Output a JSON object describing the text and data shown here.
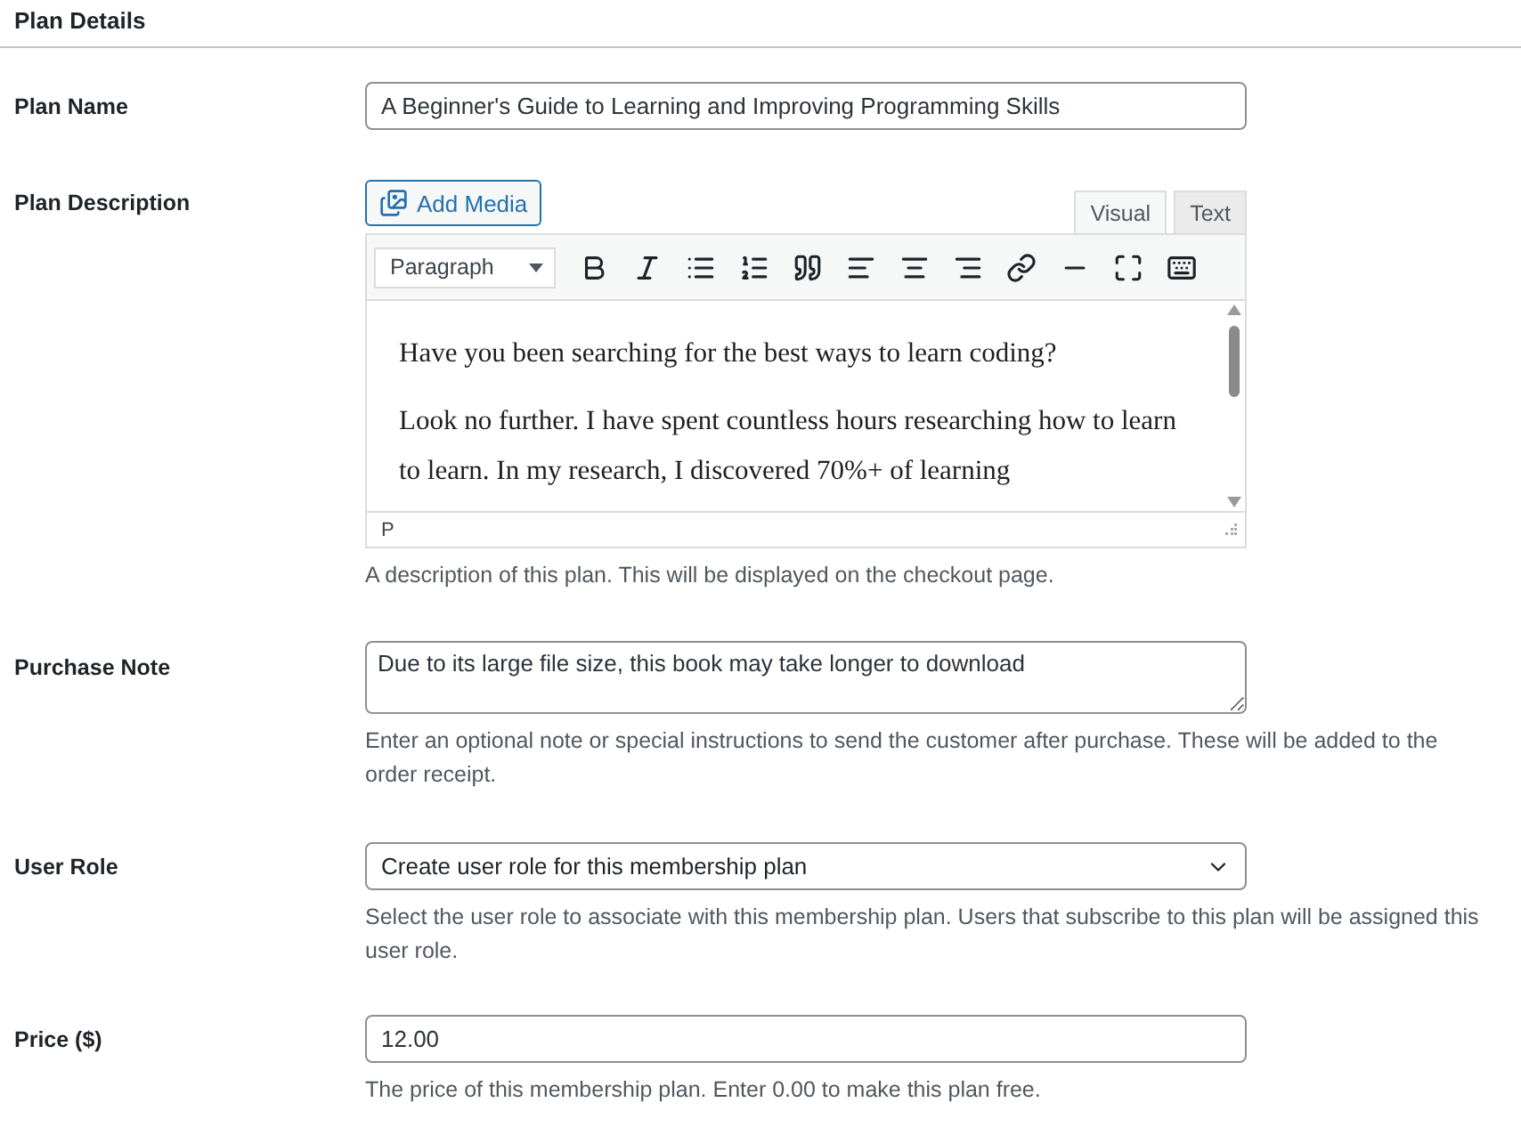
{
  "section_title": "Plan Details",
  "plan_name": {
    "label": "Plan Name",
    "value": "A Beginner's Guide to Learning and Improving Programming Skills"
  },
  "plan_description": {
    "label": "Plan Description",
    "add_media": "Add Media",
    "tabs": [
      {
        "label": "Visual",
        "selected": true
      },
      {
        "label": "Text",
        "selected": false
      }
    ],
    "format": "Paragraph",
    "toolbar": [
      {
        "kind": "bold"
      },
      {
        "kind": "italic"
      },
      {
        "kind": "bullets"
      },
      {
        "kind": "numbers"
      },
      {
        "kind": "quote"
      },
      {
        "kind": "align-left"
      },
      {
        "kind": "align-center"
      },
      {
        "kind": "align-right"
      },
      {
        "kind": "link"
      },
      {
        "kind": "more"
      },
      {
        "kind": "fullscreen"
      },
      {
        "kind": "kitchen-sink"
      }
    ],
    "paragraphs": [
      "Have you been searching for the best ways to learn coding?",
      "Look no further. I have spent countless hours researching how to learn to learn. In my research, I discovered 70%+ of learning"
    ],
    "path": "P",
    "hint": "A description of this plan. This will be displayed on the checkout page."
  },
  "purchase_note": {
    "label": "Purchase Note",
    "value": "Due to its large file size, this book may take longer to download",
    "hint": "Enter an optional note or special instructions to send the customer after purchase. These will be added to the order receipt."
  },
  "user_role": {
    "label": "User Role",
    "value": "Create user role for this membership plan",
    "hint": "Select the user role to associate with this membership plan. Users that subscribe to this plan will be assigned this user role."
  },
  "price": {
    "label": "Price ($)",
    "value": "12.00",
    "hint": "The price of this membership plan. Enter 0.00 to make this plan free."
  }
}
